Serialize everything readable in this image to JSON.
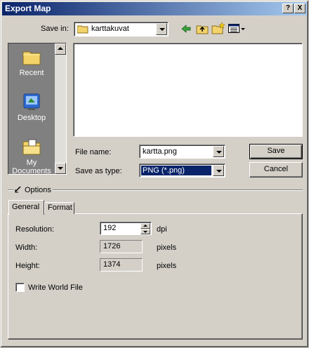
{
  "window": {
    "title": "Export Map",
    "help_glyph": "?",
    "close_glyph": "X"
  },
  "save_in": {
    "label": "Save in:",
    "folder": "karttakuvat"
  },
  "places": [
    {
      "label": "Recent"
    },
    {
      "label": "Desktop"
    },
    {
      "label": "My Documents"
    }
  ],
  "file_name": {
    "label": "File name:",
    "value": "kartta.png"
  },
  "save_as_type": {
    "label": "Save as type:",
    "value": "PNG (*.png)"
  },
  "buttons": {
    "save": "Save",
    "cancel": "Cancel"
  },
  "options": {
    "label": "Options"
  },
  "tabs": {
    "general": "General",
    "format": "Format"
  },
  "general": {
    "resolution_label": "Resolution:",
    "resolution_value": "192",
    "resolution_unit": "dpi",
    "width_label": "Width:",
    "width_value": "1726",
    "width_unit": "pixels",
    "height_label": "Height:",
    "height_value": "1374",
    "height_unit": "pixels",
    "world_file_label": "Write World File"
  }
}
